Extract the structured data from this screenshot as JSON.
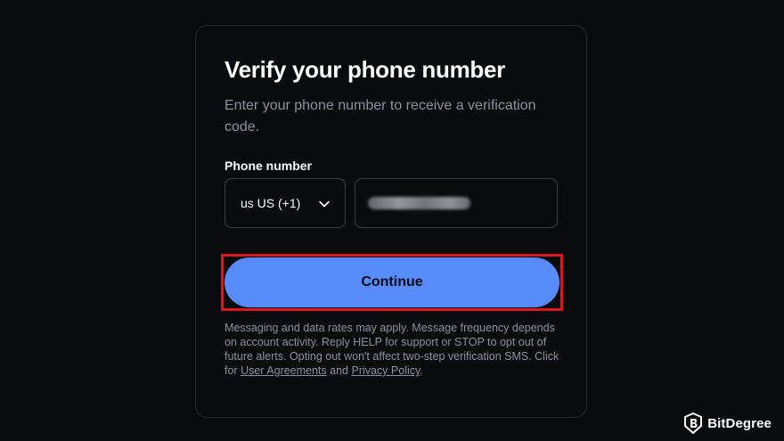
{
  "page": {
    "title": "Verify your phone number",
    "subtitle": "Enter your phone number to receive a verification code."
  },
  "form": {
    "phone_label": "Phone number",
    "country_value": "us US (+1)",
    "phone_value": ""
  },
  "actions": {
    "continue_label": "Continue"
  },
  "disclaimer": {
    "text_before": "Messaging and data rates may apply. Message frequency depends on account activity. Reply HELP for support or STOP to opt out of future alerts. Opting out won't affect two-step verification SMS. Click for ",
    "user_agreements_link": "User Agreements",
    "text_middle": " and ",
    "privacy_policy_link": "Privacy Policy",
    "text_after": "."
  },
  "watermark": {
    "brand": "BitDegree"
  },
  "colors": {
    "background": "#0a0b0d",
    "accent": "#578bfa",
    "highlight": "#e0141e",
    "muted_text": "#8a919e"
  }
}
